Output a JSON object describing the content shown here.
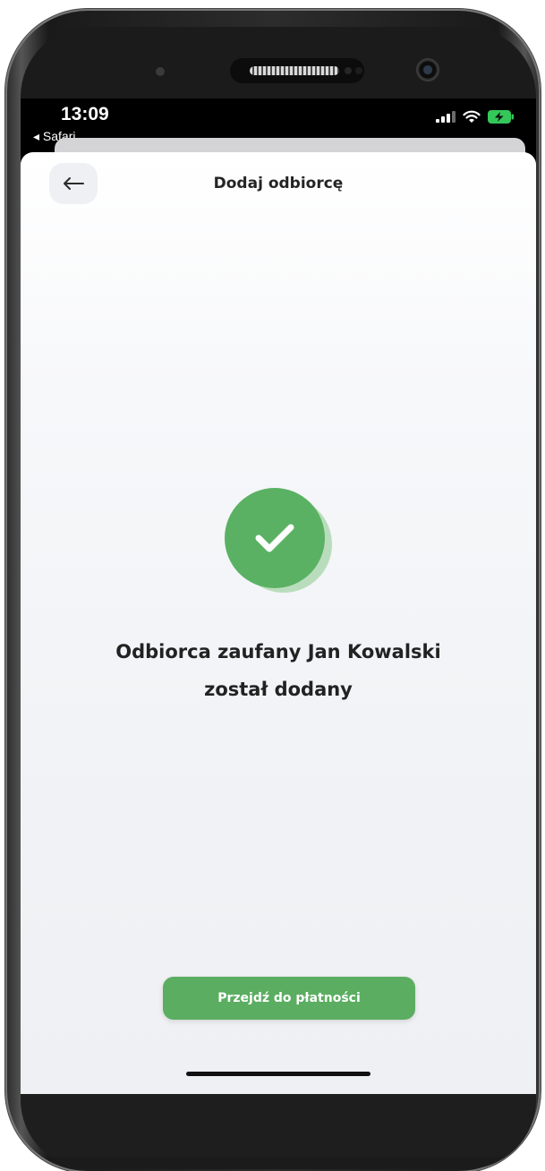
{
  "status_bar": {
    "time": "13:09",
    "back_app_label": "◂ Safari"
  },
  "header": {
    "title": "Dodaj odbiorcę",
    "back_icon": "arrow-left-icon"
  },
  "success": {
    "icon": "check-icon",
    "line1": "Odbiorca zaufany Jan Kowalski",
    "line2": "został dodany"
  },
  "actions": {
    "primary_label": "Przejdź do płatności"
  },
  "colors": {
    "accent_green": "#5ab163",
    "button_green": "#5bae61",
    "battery_green": "#34c759"
  }
}
